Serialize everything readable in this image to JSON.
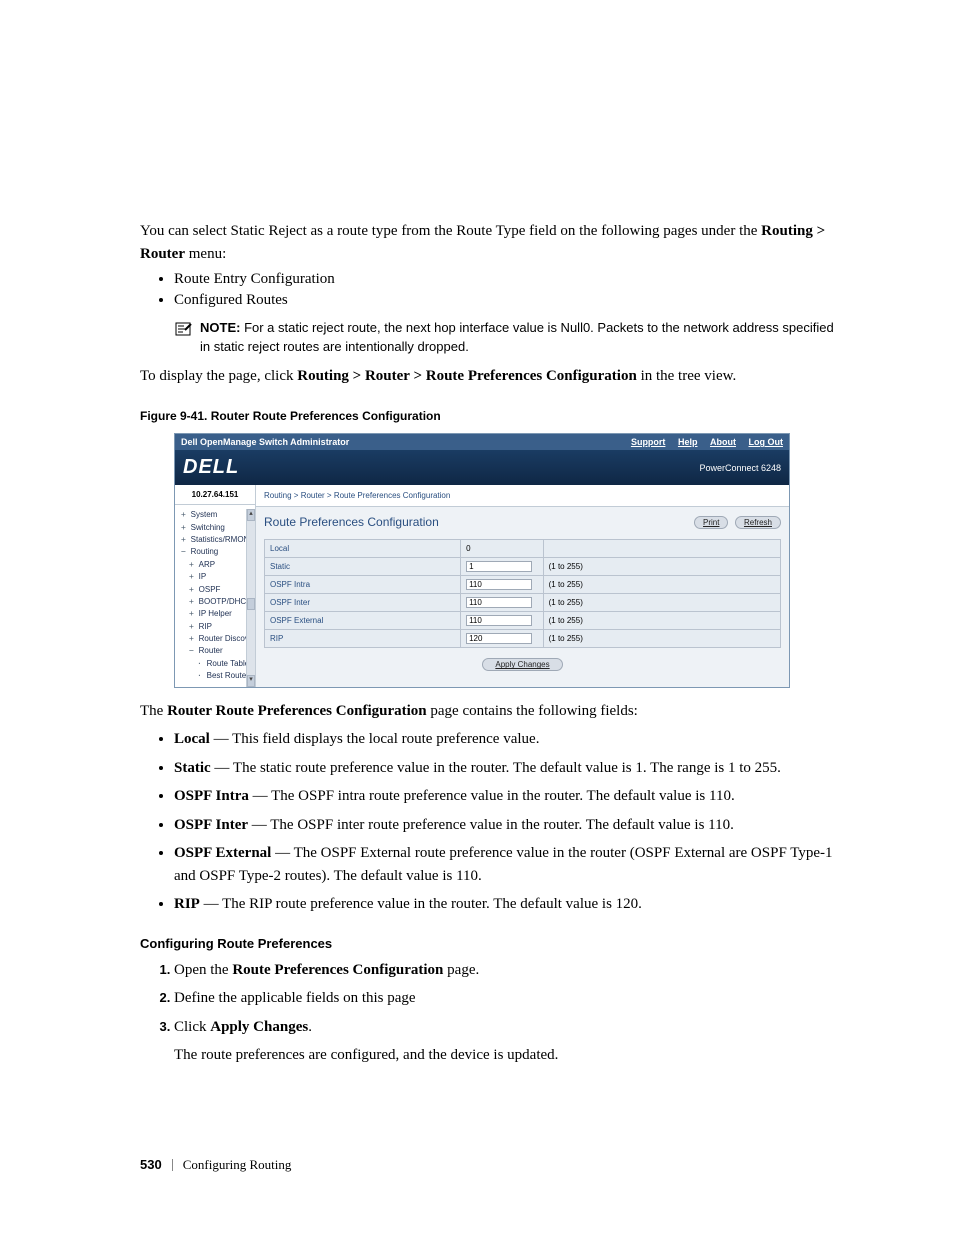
{
  "intro": {
    "p1_a": "You can select Static Reject as a route type from the Route Type field on the following pages under the ",
    "p1_b": "Routing > Router",
    "p1_c": " menu:",
    "bullets": [
      "Route Entry Configuration",
      "Configured Routes"
    ],
    "note_label": "NOTE:",
    "note_text": " For a static reject route, the next hop interface value is Null0. Packets to the network address specified in static reject routes are intentionally dropped.",
    "display_a": "To display the page, click ",
    "display_b": "Routing > Router > Route Preferences Configuration",
    "display_c": " in the tree view."
  },
  "figure_caption": "Figure 9-41.    Router Route Preferences Configuration",
  "app": {
    "title": "Dell OpenManage Switch Administrator",
    "links": {
      "support": "Support",
      "help": "Help",
      "about": "About",
      "logout": "Log Out"
    },
    "logo": "DELL",
    "model": "PowerConnect 6248",
    "ip": "10.27.64.151",
    "tree": [
      {
        "lvl": 1,
        "sym": "+",
        "label": "System"
      },
      {
        "lvl": 1,
        "sym": "+",
        "label": "Switching"
      },
      {
        "lvl": 1,
        "sym": "+",
        "label": "Statistics/RMON"
      },
      {
        "lvl": 1,
        "sym": "−",
        "label": "Routing"
      },
      {
        "lvl": 2,
        "sym": "+",
        "label": "ARP"
      },
      {
        "lvl": 2,
        "sym": "+",
        "label": "IP"
      },
      {
        "lvl": 2,
        "sym": "+",
        "label": "OSPF"
      },
      {
        "lvl": 2,
        "sym": "+",
        "label": "BOOTP/DHCP Rel"
      },
      {
        "lvl": 2,
        "sym": "+",
        "label": "IP Helper"
      },
      {
        "lvl": 2,
        "sym": "+",
        "label": "RIP"
      },
      {
        "lvl": 2,
        "sym": "+",
        "label": "Router Discovery"
      },
      {
        "lvl": 2,
        "sym": "−",
        "label": "Router"
      },
      {
        "lvl": 3,
        "sym": "",
        "label": "Route Table"
      },
      {
        "lvl": 3,
        "sym": "",
        "label": "Best Routes Tab"
      }
    ],
    "breadcrumb": "Routing > Router > Route Preferences Configuration",
    "main_title": "Route Preferences Configuration",
    "buttons": {
      "print": "Print",
      "refresh": "Refresh",
      "apply": "Apply Changes"
    },
    "rows": [
      {
        "label": "Local",
        "value": "0",
        "range": "",
        "editable": false
      },
      {
        "label": "Static",
        "value": "1",
        "range": "(1 to 255)",
        "editable": true
      },
      {
        "label": "OSPF Intra",
        "value": "110",
        "range": "(1 to 255)",
        "editable": true
      },
      {
        "label": "OSPF Inter",
        "value": "110",
        "range": "(1 to 255)",
        "editable": true
      },
      {
        "label": "OSPF External",
        "value": "110",
        "range": "(1 to 255)",
        "editable": true
      },
      {
        "label": "RIP",
        "value": "120",
        "range": "(1 to 255)",
        "editable": true
      }
    ]
  },
  "after": {
    "p_a": "The ",
    "p_b": "Router Route Preferences Configuration",
    "p_c": " page contains the following fields:",
    "fields": [
      {
        "name": "Local",
        "desc": " — This field displays the local route preference value."
      },
      {
        "name": "Static",
        "desc": " — The static route preference value in the router. The default value is 1. The range is 1 to 255."
      },
      {
        "name": "OSPF Intra",
        "desc": " — The OSPF intra route preference value in the router. The default value is 110."
      },
      {
        "name": "OSPF Inter",
        "desc": " — The OSPF inter route preference value in the router. The default value is 110."
      },
      {
        "name": "OSPF External",
        "desc": " — The OSPF External route preference value in the router (OSPF External are OSPF Type-1 and OSPF Type-2 routes). The default value is 110."
      },
      {
        "name": "RIP",
        "desc": " — The RIP route preference value in the router. The default value is 120."
      }
    ]
  },
  "procedure": {
    "heading": "Configuring Route Preferences",
    "steps": [
      {
        "pre": "Open the ",
        "bold": "Route Preferences Configuration",
        "post": " page."
      },
      {
        "pre": "Define the applicable fields on this page",
        "bold": "",
        "post": ""
      },
      {
        "pre": "Click ",
        "bold": "Apply Changes",
        "post": "."
      }
    ],
    "result": "The route preferences are configured, and the device is updated."
  },
  "footer": {
    "page": "530",
    "section": "Configuring Routing"
  }
}
